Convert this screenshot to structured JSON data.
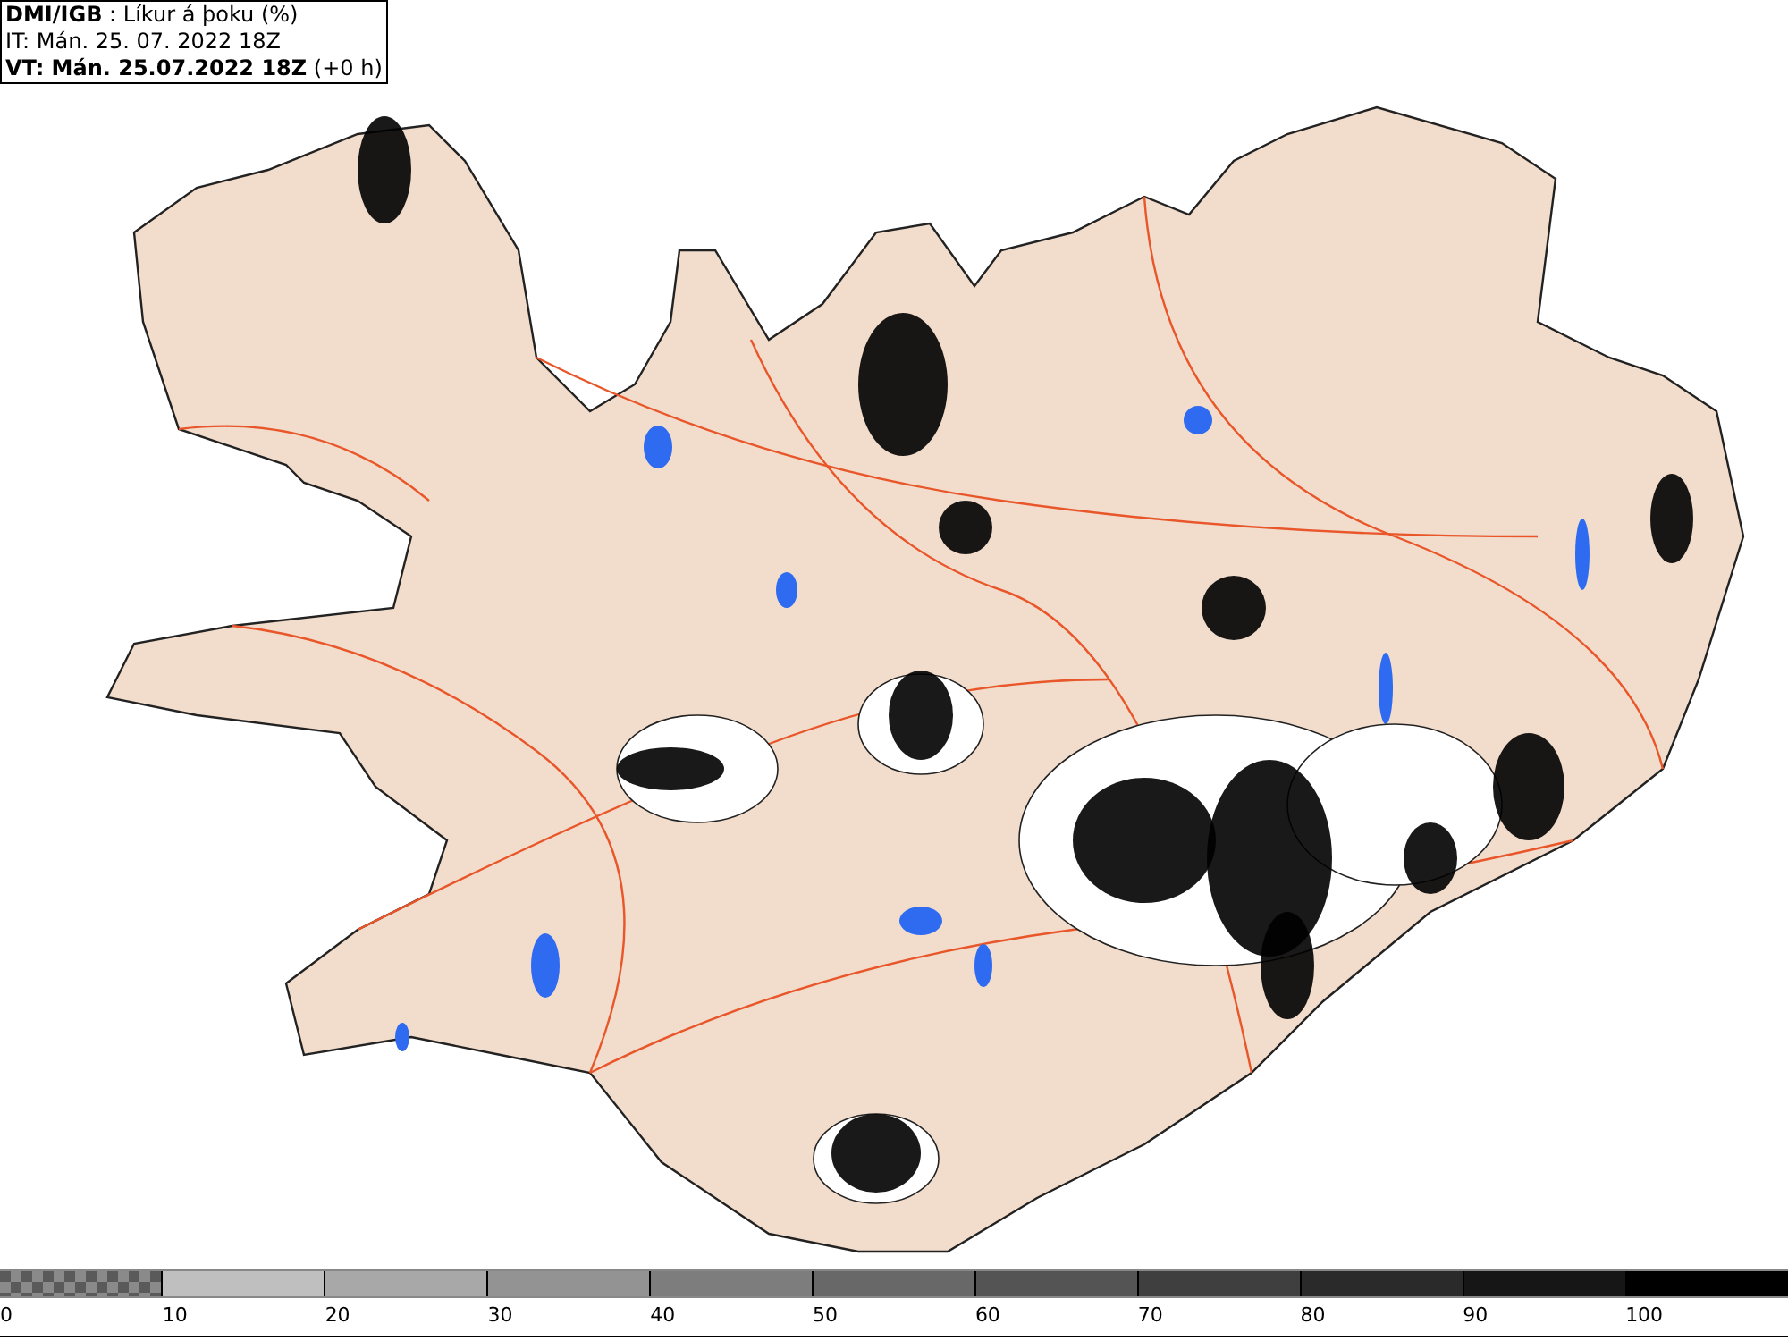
{
  "header": {
    "title": "**DMI/IGB** : Líkur á þoku (%)",
    "issue_time": "IT: Mán. 25. 07. 2022 18Z",
    "valid_time": "**VT: Mán. 25.07.2022 18Z** (+0 h)"
  },
  "legend": {
    "segments": [
      {
        "kind": "checker",
        "color": "#5a5a5a"
      },
      {
        "kind": "solid",
        "color": "#bfbfbf"
      },
      {
        "kind": "solid",
        "color": "#a8a8a8"
      },
      {
        "kind": "solid",
        "color": "#939393"
      },
      {
        "kind": "solid",
        "color": "#7d7d7d"
      },
      {
        "kind": "solid",
        "color": "#686868"
      },
      {
        "kind": "solid",
        "color": "#545454"
      },
      {
        "kind": "solid",
        "color": "#3f3f3f"
      },
      {
        "kind": "solid",
        "color": "#2a2a2a"
      },
      {
        "kind": "solid",
        "color": "#161616"
      },
      {
        "kind": "solid",
        "color": "#000000"
      }
    ],
    "labels": [
      "0",
      "10",
      "20",
      "30",
      "40",
      "50",
      "60",
      "70",
      "80",
      "90",
      "100"
    ]
  }
}
